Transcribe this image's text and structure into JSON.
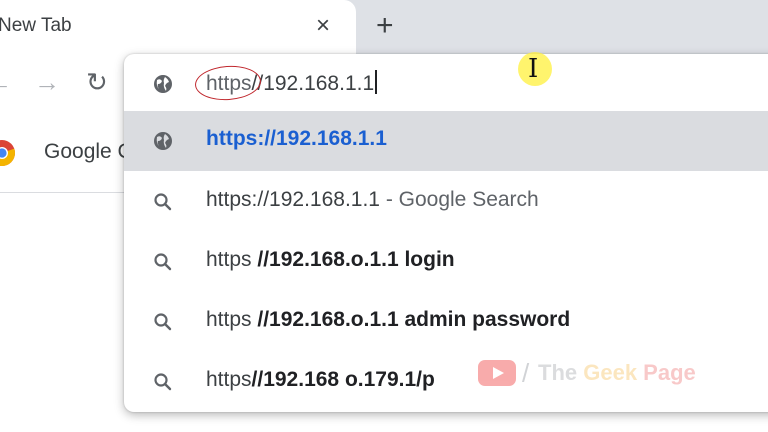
{
  "tabs": {
    "active": {
      "title": "New Tab",
      "close_icon": "×"
    },
    "new_tab_icon": "+"
  },
  "toolbar": {
    "back_icon": "←",
    "forward_icon": "→",
    "reload_icon": "↻"
  },
  "bookmarks": {
    "item_label": "Google C"
  },
  "omnibox": {
    "input_prefix": "https",
    "input_rest": "//192.168.1.1",
    "suggestions": [
      {
        "icon": "globe-icon",
        "text": "https://192.168.1.1"
      },
      {
        "icon": "search-icon",
        "text": "https://192.168.1.1",
        "suffix": "- Google Search"
      },
      {
        "icon": "search-icon",
        "plain": "https ",
        "bold": "//192.168.o.1.1 login"
      },
      {
        "icon": "search-icon",
        "plain": "https ",
        "bold": "//192.168.o.1.1 admin password"
      },
      {
        "icon": "search-icon",
        "plain": "https",
        "bold": "//192.168 o.179.1/p"
      }
    ]
  },
  "cursor_icon": "I",
  "watermark": {
    "slash": "/",
    "word1": "The ",
    "word2": "Geek",
    "word3": " Page"
  },
  "colors": {
    "link": "#1a5fd1",
    "selected_row": "#dadce0",
    "tabstrip": "#dee1e6",
    "annotation": "#c0272d"
  }
}
